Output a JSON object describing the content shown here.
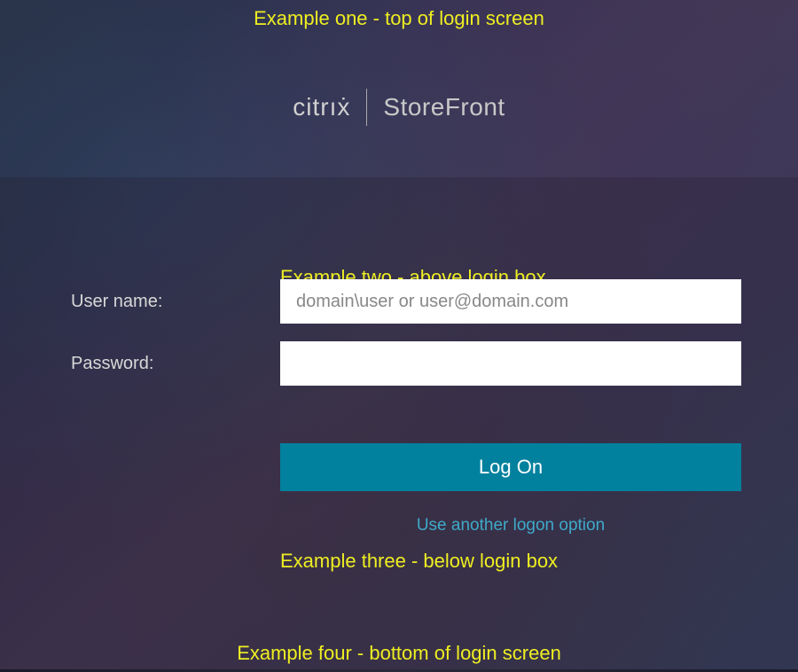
{
  "annotations": {
    "example_one": "Example one - top of login screen",
    "example_two": "Example two - above login box",
    "example_three": "Example three - below login box",
    "example_four": "Example four - bottom of login screen"
  },
  "logo": {
    "brand": "citrıẋ",
    "product": "StoreFront"
  },
  "form": {
    "username_label": "User name:",
    "username_placeholder": "domain\\user or user@domain.com",
    "username_value": "",
    "password_label": "Password:",
    "password_value": "",
    "logon_button": "Log On",
    "alt_logon_link": "Use another logon option"
  },
  "colors": {
    "annotation": "#eeee22",
    "button_bg": "#02819e",
    "link": "#3fa9c9"
  }
}
